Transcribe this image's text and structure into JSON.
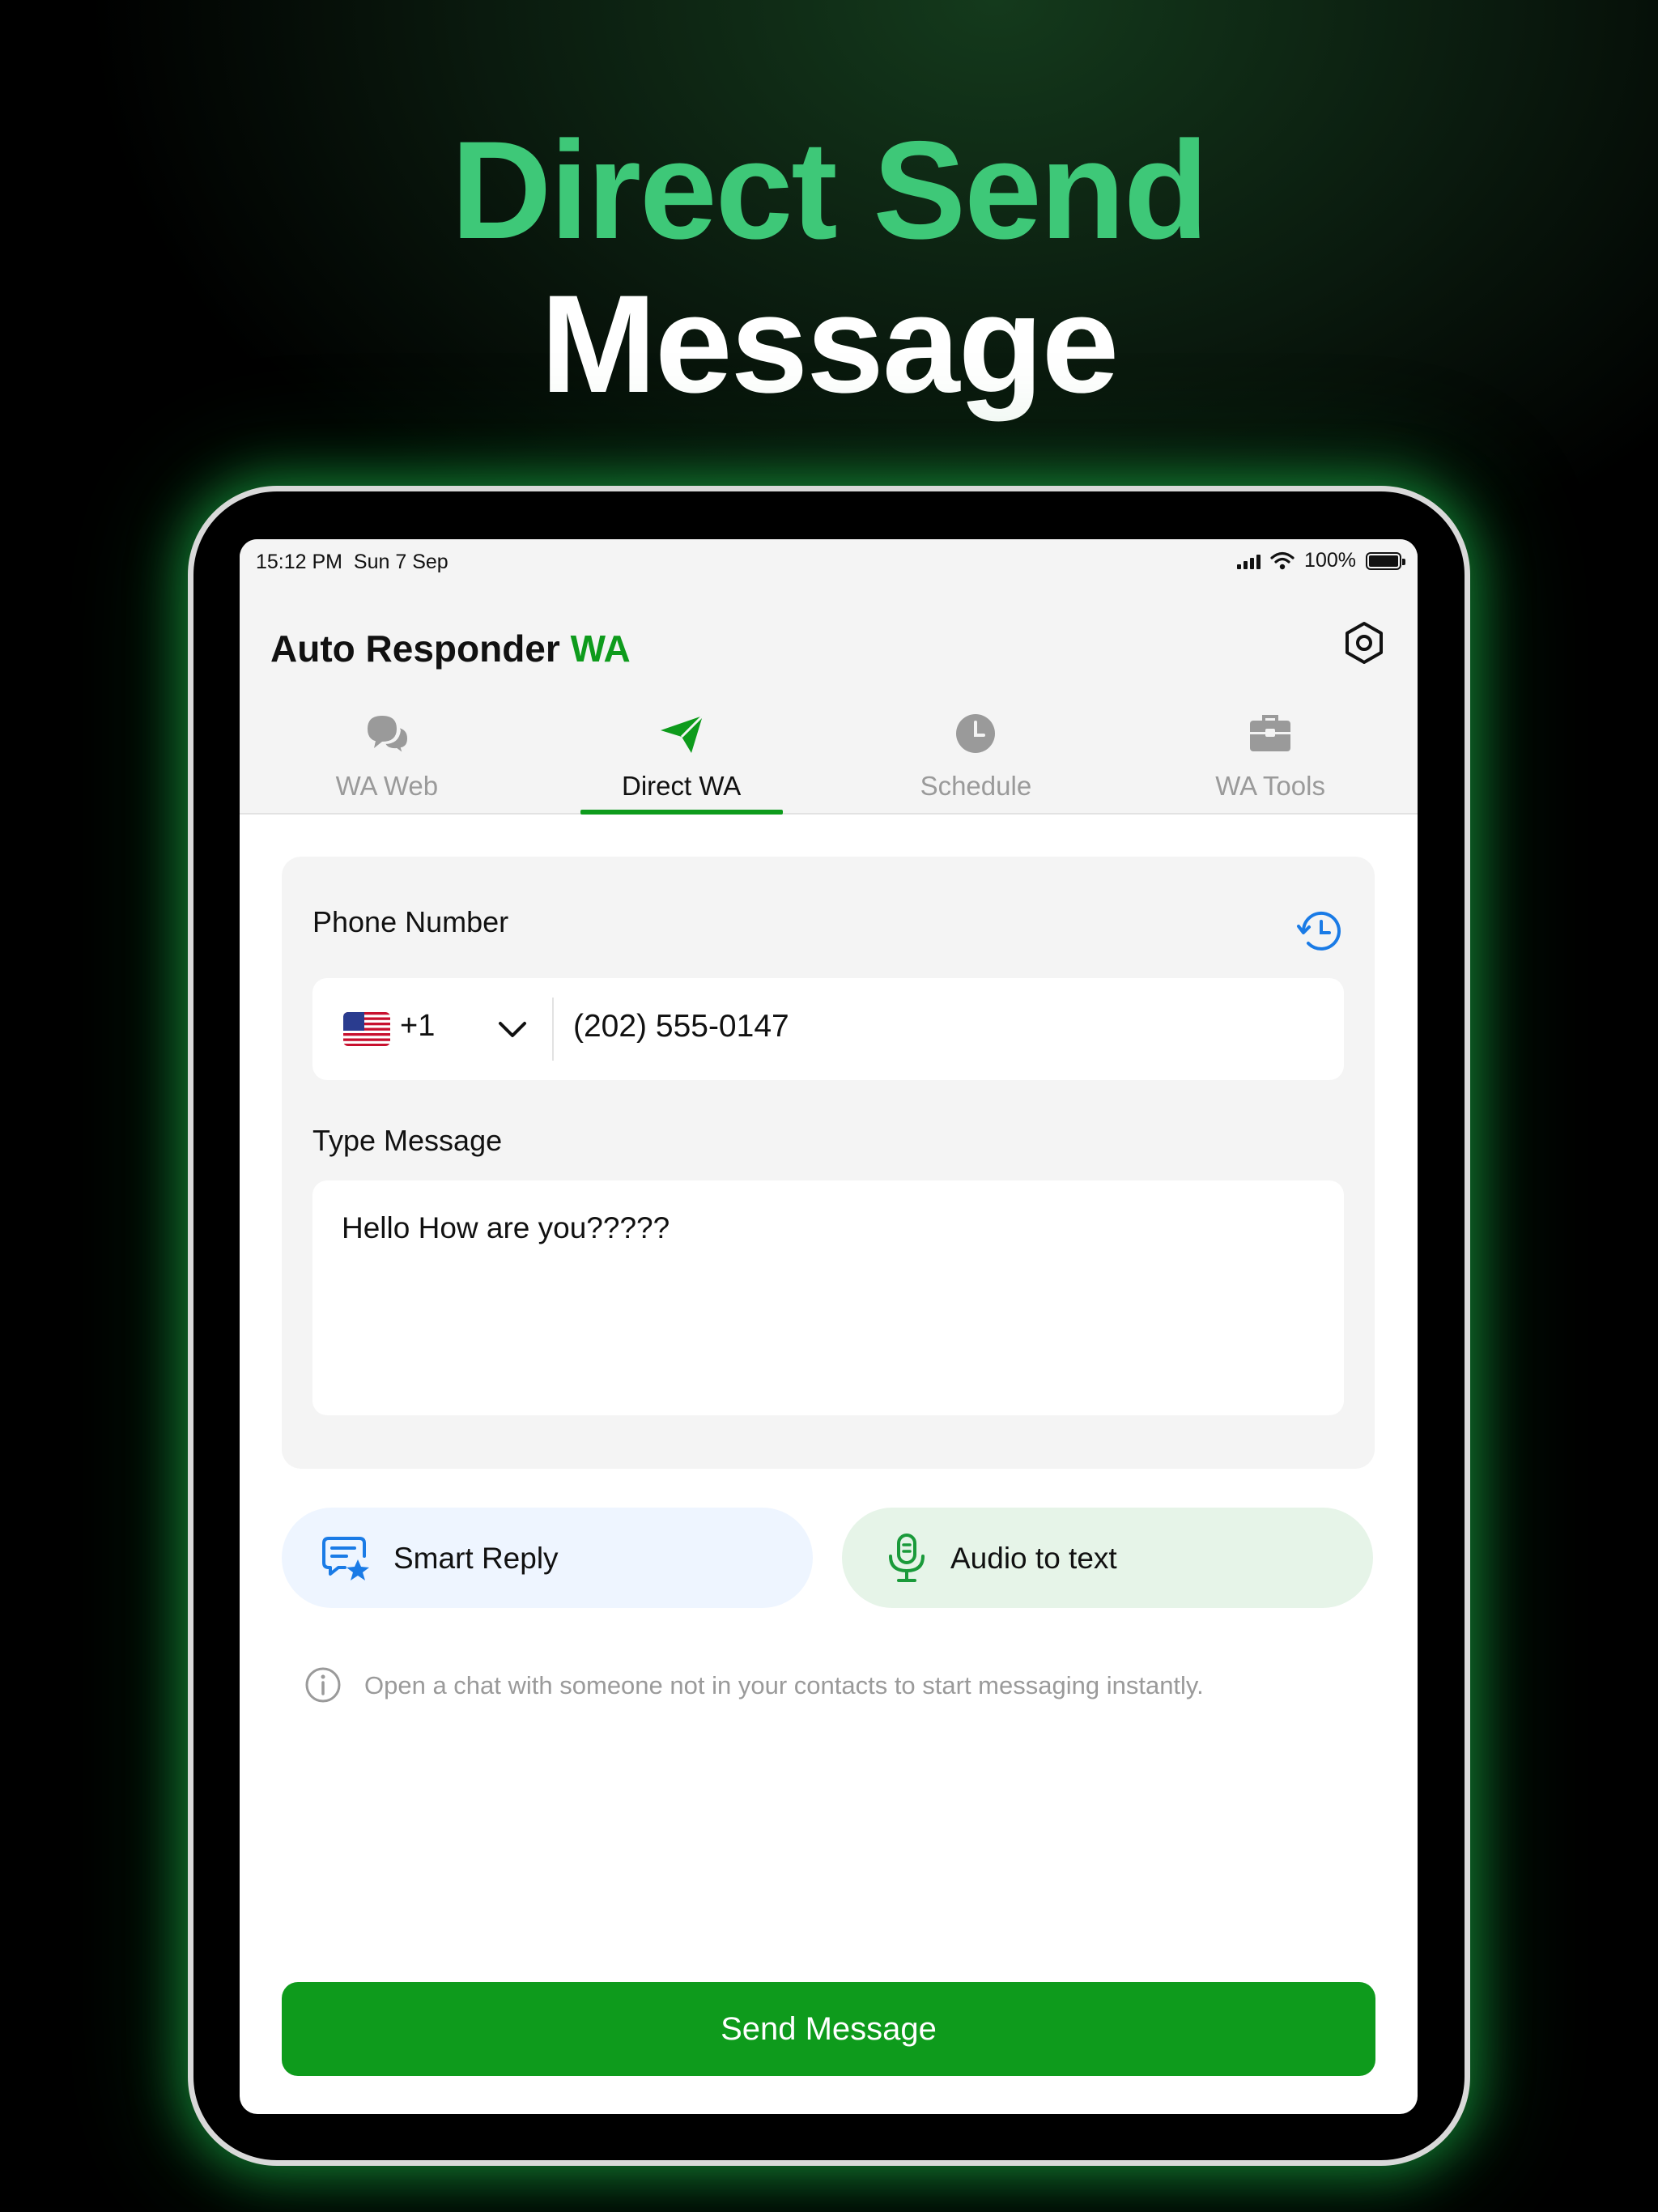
{
  "headline": {
    "line1": "Direct Send",
    "line2": "Message"
  },
  "status_bar": {
    "time": "15:12 PM",
    "date": "Sun 7 Sep",
    "battery": "100%"
  },
  "app": {
    "title_main": "Auto Responder",
    "title_accent": "WA"
  },
  "tabs": [
    {
      "label": "WA Web",
      "icon": "chat-bubbles-icon",
      "active": false
    },
    {
      "label": "Direct WA",
      "icon": "paper-plane-icon",
      "active": true
    },
    {
      "label": "Schedule",
      "icon": "clock-icon",
      "active": false
    },
    {
      "label": "WA Tools",
      "icon": "toolbox-icon",
      "active": false
    }
  ],
  "form": {
    "phone_label": "Phone Number",
    "country_code": "+1",
    "country_flag": "us-flag-icon",
    "phone_value": "(202) 555-0147",
    "message_label": "Type Message",
    "message_value": "Hello How are you?????"
  },
  "actions": {
    "smart_reply": "Smart Reply",
    "audio_to_text": "Audio to text"
  },
  "info_text": "Open a chat with someone not in your contacts to start messaging instantly.",
  "send_button": "Send Message",
  "colors": {
    "accent_green": "#0e9b1c",
    "headline_green": "#3ec878",
    "smart_reply_blue": "#1a7be6"
  }
}
